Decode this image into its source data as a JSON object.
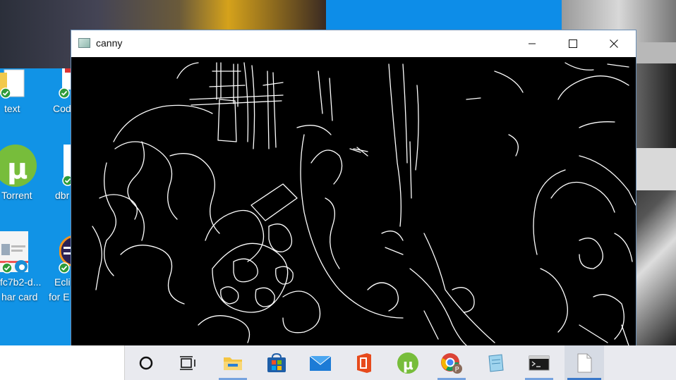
{
  "window": {
    "title": "canny",
    "controls": {
      "minimize": "–",
      "maximize": "☐",
      "close": "✕"
    }
  },
  "desktop": {
    "icons": [
      {
        "label": "text",
        "icon": "text-file-icon"
      },
      {
        "label": "Cod",
        "icon": "code-file-icon"
      },
      {
        "label": "Torrent",
        "icon": "utorrent-icon"
      },
      {
        "label": "dbr",
        "icon": "document-icon"
      },
      {
        "label": "fc7b2-d...",
        "label2": "har card",
        "icon": "image-file-icon"
      },
      {
        "label": "Ecli",
        "label2": "for E",
        "icon": "eclipse-icon"
      }
    ]
  },
  "taskbar": {
    "items": [
      {
        "name": "cortana",
        "icon": "cortana-circle-icon"
      },
      {
        "name": "task-view",
        "icon": "task-view-icon"
      },
      {
        "name": "file-explorer",
        "icon": "folder-icon"
      },
      {
        "name": "store",
        "icon": "store-icon"
      },
      {
        "name": "mail",
        "icon": "mail-icon"
      },
      {
        "name": "office",
        "icon": "office-icon"
      },
      {
        "name": "utorrent",
        "icon": "utorrent-icon"
      },
      {
        "name": "chrome",
        "icon": "chrome-icon"
      },
      {
        "name": "notepad",
        "icon": "notepad-icon"
      },
      {
        "name": "terminal",
        "icon": "terminal-icon"
      },
      {
        "name": "blank-document",
        "icon": "document-icon"
      }
    ]
  },
  "colors": {
    "desktop": "#1193e6",
    "taskbar": "#e9eaef",
    "accent": "#3a78c9"
  }
}
